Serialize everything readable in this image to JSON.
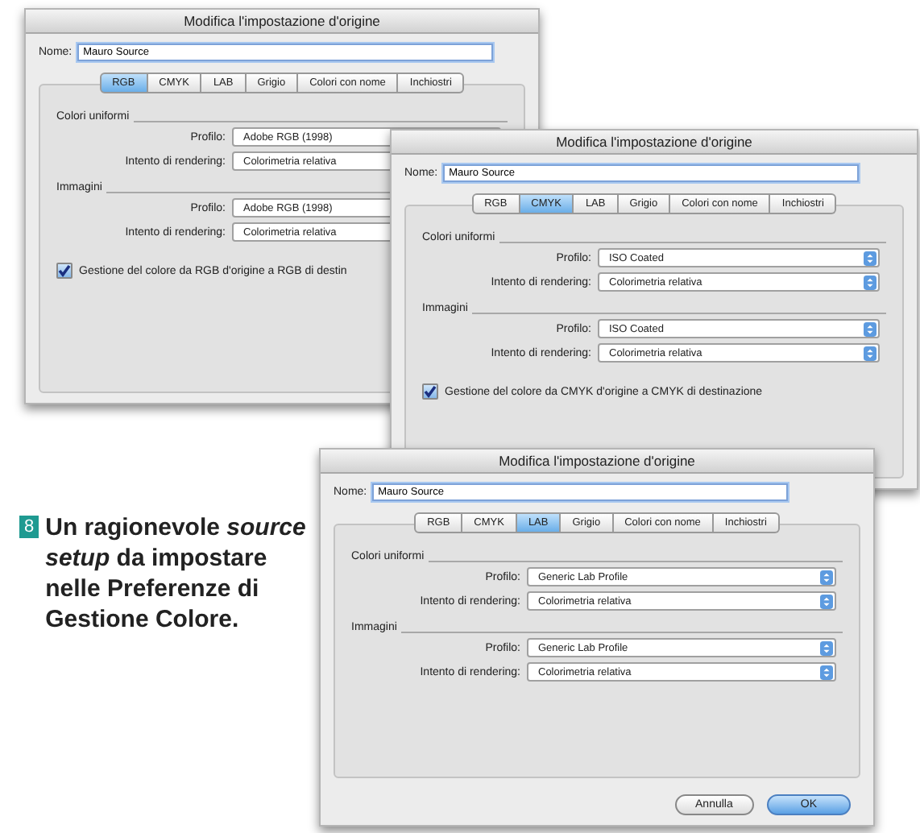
{
  "windows": [
    {
      "title": "Modifica l'impostazione d'origine",
      "name_label": "Nome:",
      "name_value": "Mauro Source",
      "tabs": [
        {
          "label": "RGB",
          "selected": true
        },
        {
          "label": "CMYK",
          "selected": false
        },
        {
          "label": "LAB",
          "selected": false
        },
        {
          "label": "Grigio",
          "selected": false
        },
        {
          "label": "Colori con nome",
          "selected": false
        },
        {
          "label": "Inchiostri",
          "selected": false
        }
      ],
      "sections": [
        {
          "title": "Colori uniformi",
          "rows": [
            {
              "label": "Profilo:",
              "value": "Adobe RGB (1998)"
            },
            {
              "label": "Intento di rendering:",
              "value": "Colorimetria relativa"
            }
          ]
        },
        {
          "title": "Immagini",
          "rows": [
            {
              "label": "Profilo:",
              "value": "Adobe RGB (1998)"
            },
            {
              "label": "Intento di rendering:",
              "value": "Colorimetria relativa"
            }
          ]
        }
      ],
      "checkbox": {
        "label": "Gestione del colore da RGB d'origine a RGB di destin",
        "checked": true
      }
    },
    {
      "title": "Modifica l'impostazione d'origine",
      "name_label": "Nome:",
      "name_value": "Mauro Source",
      "tabs": [
        {
          "label": "RGB",
          "selected": false
        },
        {
          "label": "CMYK",
          "selected": true
        },
        {
          "label": "LAB",
          "selected": false
        },
        {
          "label": "Grigio",
          "selected": false
        },
        {
          "label": "Colori con nome",
          "selected": false
        },
        {
          "label": "Inchiostri",
          "selected": false
        }
      ],
      "sections": [
        {
          "title": "Colori uniformi",
          "rows": [
            {
              "label": "Profilo:",
              "value": "ISO Coated"
            },
            {
              "label": "Intento di rendering:",
              "value": "Colorimetria relativa"
            }
          ]
        },
        {
          "title": "Immagini",
          "rows": [
            {
              "label": "Profilo:",
              "value": "ISO Coated"
            },
            {
              "label": "Intento di rendering:",
              "value": "Colorimetria relativa"
            }
          ]
        }
      ],
      "checkbox": {
        "label": "Gestione del colore da CMYK d'origine a CMYK di destinazione",
        "checked": true
      }
    },
    {
      "title": "Modifica l'impostazione d'origine",
      "name_label": "Nome:",
      "name_value": "Mauro Source",
      "tabs": [
        {
          "label": "RGB",
          "selected": false
        },
        {
          "label": "CMYK",
          "selected": false
        },
        {
          "label": "LAB",
          "selected": true
        },
        {
          "label": "Grigio",
          "selected": false
        },
        {
          "label": "Colori con nome",
          "selected": false
        },
        {
          "label": "Inchiostri",
          "selected": false
        }
      ],
      "sections": [
        {
          "title": "Colori uniformi",
          "rows": [
            {
              "label": "Profilo:",
              "value": "Generic Lab Profile"
            },
            {
              "label": "Intento di rendering:",
              "value": "Colorimetria relativa"
            }
          ]
        },
        {
          "title": "Immagini",
          "rows": [
            {
              "label": "Profilo:",
              "value": "Generic Lab Profile"
            },
            {
              "label": "Intento di rendering:",
              "value": "Colorimetria relativa"
            }
          ]
        }
      ],
      "buttons": [
        {
          "label": "Annulla",
          "default": false
        },
        {
          "label": "OK",
          "default": true
        }
      ]
    }
  ],
  "caption": {
    "number": "8",
    "text": "Un ragionevole *source setup* da impostare nelle Preferenze di Gestione Colore."
  }
}
